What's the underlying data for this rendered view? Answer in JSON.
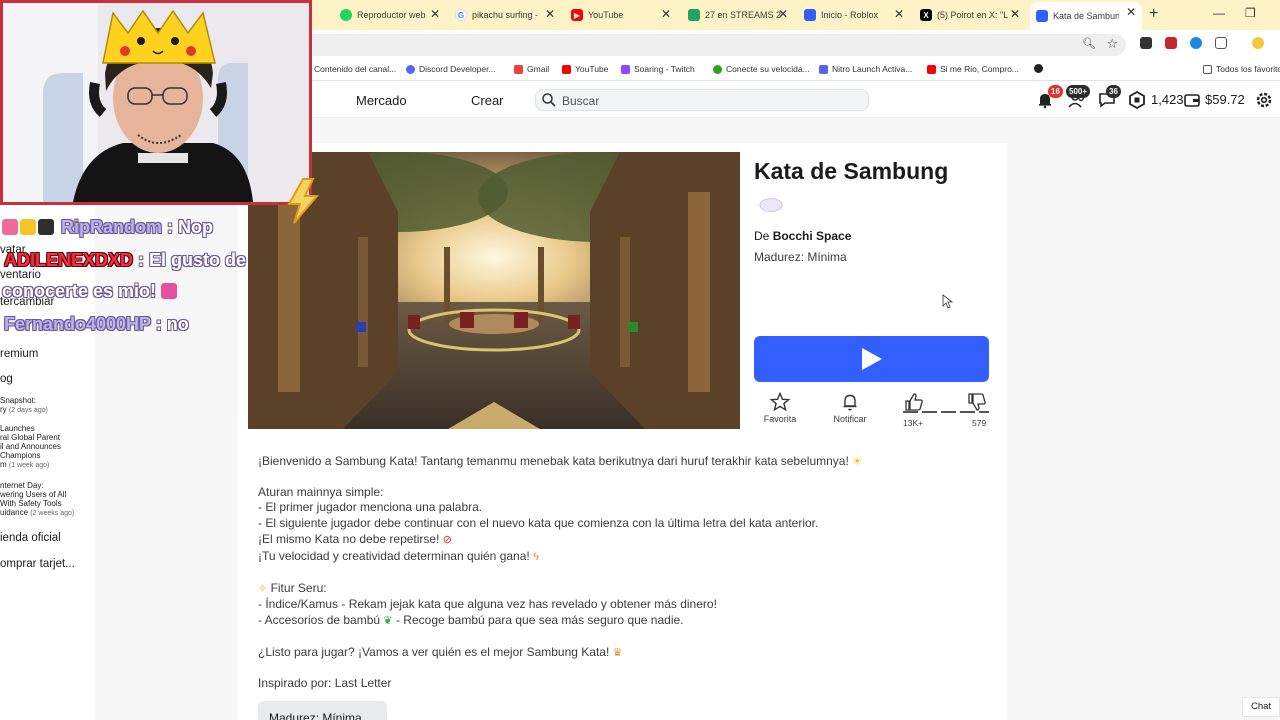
{
  "browser": {
    "tabs": [
      {
        "title": "Reproductor web",
        "color": "#1ed760"
      },
      {
        "title": "pikachu surfing -",
        "color": "#4285f4"
      },
      {
        "title": "YouTube",
        "color": "#ff0000"
      },
      {
        "title": "27 en STREAMS 2",
        "color": "#21a366"
      },
      {
        "title": "Inicio - Roblox",
        "color": "#335fff"
      },
      {
        "title": "(5) Poirot en X: \"L",
        "color": "#000000"
      },
      {
        "title": "Kata de Sambung",
        "color": "#335fff",
        "active": true
      }
    ],
    "bookmarks": [
      {
        "label": "Contenido del canal...",
        "color": "#ff0000"
      },
      {
        "label": "Discord Developer...",
        "color": "#5865f2"
      },
      {
        "label": "Gmail",
        "color": "#ea4335"
      },
      {
        "label": "YouTube",
        "color": "#ff0000"
      },
      {
        "label": "Soaring - Twitch",
        "color": "#9146ff"
      },
      {
        "label": "Conecte su velocida...",
        "color": "#2ca01c"
      },
      {
        "label": "Nitro Launch Activa...",
        "color": "#5865f2"
      },
      {
        "label": "Si me Rio, Compro...",
        "color": "#ff0000"
      },
      {
        "label": "Todos los favoritos",
        "color": "#555555"
      }
    ]
  },
  "nav": {
    "marketplace": "Mercado",
    "create": "Crear",
    "search_placeholder": "Buscar",
    "notifications_count": "16",
    "friends_count": "500+",
    "messages_count": "36",
    "robux": "1,423",
    "balance": "$59.72"
  },
  "sidebar": {
    "items": [
      "vatar",
      "ventario",
      "tercambiar",
      "remium",
      "og"
    ],
    "blog": [
      {
        "title": "Snapshot:",
        "title2": "ry",
        "when": "(2 days ago)"
      },
      {
        "title": "Launches",
        "title2": "ral Global Parent",
        "title3": "il and Announces",
        "title4": "Champions",
        "title5": "m",
        "when": "(1 week ago)"
      },
      {
        "title": "nternet Day:",
        "title2": "wering Users of All",
        "title3": "With Safety Tools",
        "title4": "uidance",
        "when": "(2 weeks ago)"
      }
    ],
    "store": "ienda oficial",
    "gift": "omprar tarjet..."
  },
  "game": {
    "title": "Kata de Sambung",
    "creator_label": "De",
    "creator": "Bocchi Space",
    "maturity": "Madurez: Mínima",
    "favorite": "Favorita",
    "notify": "Notificar",
    "likes": "13K+",
    "dislikes": "579",
    "play_label": "Jugar"
  },
  "description": {
    "welcome": "¡Bienvenido a Sambung Kata! Tantang temanmu menebak kata berikutnya dari huruf terakhir kata sebelumnya!",
    "rules_title": "Aturan mainnya simple:",
    "rule1": "- El primer jugador menciona una palabra.",
    "rule2": "- El siguiente jugador debe continuar con el nuevo kata que comienza con la última letra del kata anterior.",
    "rule3": "¡El mismo Kata no debe repetirse!",
    "rule4": "¡Tu velocidad y creatividad determinan quién gana!",
    "features_title": "Fitur Seru:",
    "feature1": "- Índice/Kamus - Rekam jejak kata que alguna vez has revelado y obtener más dinero!",
    "feature2a": "- Accesorios de bambú",
    "feature2b": "- Recoge bambú para que sea más seguro que nadie.",
    "ready": "¿Listo para jugar? ¡Vamos a ver quién es el mejor Sambung Kata!",
    "inspired": "Inspirado por: Last Letter",
    "maturity_chip": "Madurez: Mínima"
  },
  "chat_button": "Chat",
  "stream_chat": [
    {
      "user": "RipRandom",
      "msg": " : Nop",
      "color": "#b9b2f5"
    },
    {
      "user": "ADILENEXDXD",
      "msg": " : El gusto de",
      "msg2": "conocerte es mio!",
      "color": "#ff2a3c"
    },
    {
      "user": "Fernando4000HP",
      "msg": " : no",
      "color": "#b9b2f5"
    }
  ]
}
